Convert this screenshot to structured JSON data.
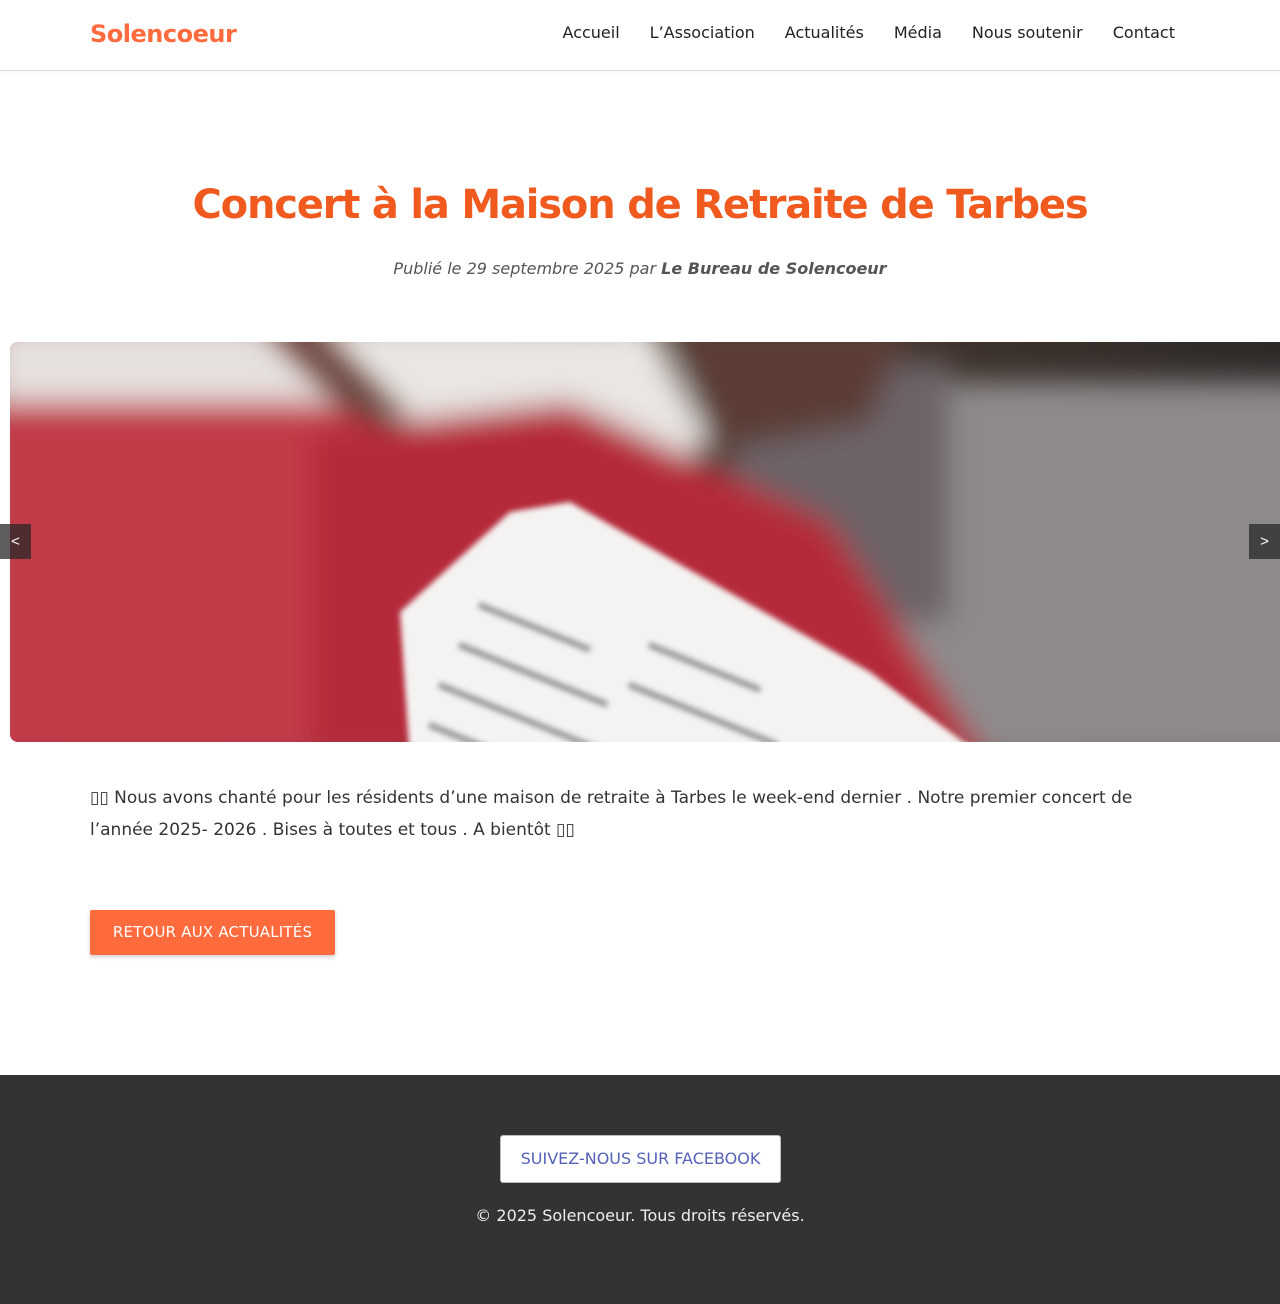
{
  "header": {
    "brand": "Solencoeur",
    "nav": [
      "Accueil",
      "L’Association",
      "Actualités",
      "Média",
      "Nous soutenir",
      "Contact"
    ]
  },
  "post": {
    "title": "Concert à la Maison de Retraite de Tarbes",
    "meta_prefix": "Publié le 29 septembre 2025 par ",
    "author": "Le Bureau de Solencoeur",
    "body": "▯▯ Nous avons chanté pour les résidents d’une maison de retraite à Tarbes le week-end dernier . Notre premier concert de l’année 2025- 2026 . Bises à toutes et tous . A bientôt ▯▯",
    "back_label": "Retour aux actualités"
  },
  "slider": {
    "prev_label": "<",
    "next_label": ">"
  },
  "footer": {
    "facebook_label": "Suivez-nous sur Facebook",
    "copyright": "© 2025 Solencoeur. Tous droits réservés."
  },
  "colors": {
    "accent": "#ff6b3d",
    "title": "#f05a1e",
    "footer_bg": "#333333",
    "facebook_text": "#5562b8"
  }
}
